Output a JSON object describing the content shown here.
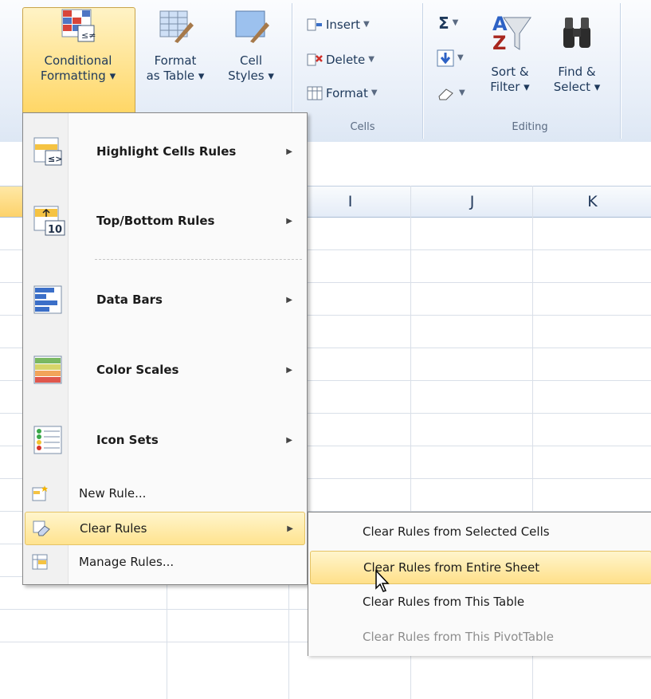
{
  "ribbon": {
    "styles_group": {
      "conditional_formatting": [
        "Conditional",
        "Formatting ▾"
      ],
      "format_as_table": [
        "Format",
        "as Table ▾"
      ],
      "cell_styles": [
        "Cell",
        "Styles ▾"
      ]
    },
    "cells_group": {
      "insert": "Insert",
      "delete": "Delete",
      "format": "Format",
      "label": "Cells"
    },
    "editing_group": {
      "sort_filter": [
        "Sort &",
        "Filter ▾"
      ],
      "find_select": [
        "Find &",
        "Select ▾"
      ],
      "label": "Editing"
    }
  },
  "grid": {
    "columns": [
      "I",
      "J",
      "K"
    ]
  },
  "menu": {
    "items": [
      {
        "label": "Highlight Cells Rules",
        "icon": "highlight-cells-icon"
      },
      {
        "label": "Top/Bottom Rules",
        "icon": "top-bottom-icon"
      },
      {
        "label": "Data Bars",
        "icon": "data-bars-icon"
      },
      {
        "label": "Color Scales",
        "icon": "color-scales-icon"
      },
      {
        "label": "Icon Sets",
        "icon": "icon-sets-icon"
      },
      {
        "label": "New Rule...",
        "icon": "new-rule-icon"
      },
      {
        "label": "Clear Rules",
        "icon": "clear-rules-icon"
      },
      {
        "label": "Manage Rules...",
        "icon": "manage-rules-icon"
      }
    ]
  },
  "submenu": {
    "items": [
      "Clear Rules from Selected Cells",
      "Clear Rules from Entire Sheet",
      "Clear Rules from This Table",
      "Clear Rules from This PivotTable"
    ]
  }
}
